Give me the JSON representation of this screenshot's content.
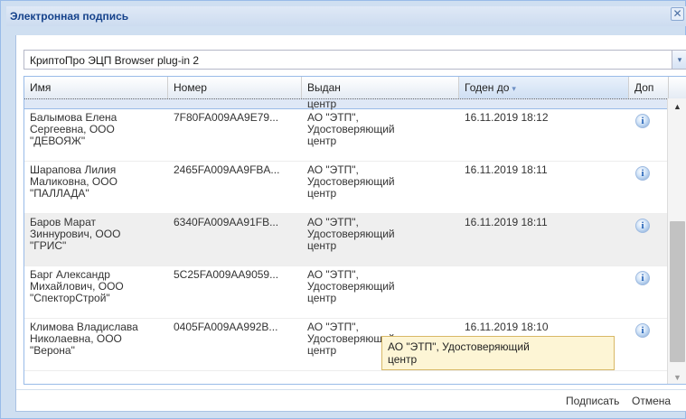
{
  "window": {
    "title": "Электронная подпись",
    "close_glyph": "✕"
  },
  "provider": {
    "value": "КриптоПро ЭЦП Browser plug-in 2",
    "trigger_glyph": "▾"
  },
  "grid": {
    "columns": [
      "Имя",
      "Номер",
      "Выдан",
      "Годен до",
      "Доп"
    ],
    "sort_glyph": "▾",
    "partial_issuer": "центр",
    "rows": [
      {
        "name": "Балымова Елена\nСергеевна, ООО\n\"ДЕВОЯЖ\"",
        "number": "7F80FA009AA9E79...",
        "issuer": "АО \"ЭТП\",\nУдостоверяющий\nцентр",
        "valid_to": "16.11.2019 18:12"
      },
      {
        "name": "Шарапова Лилия\nМаликовна, ООО\n\"ПАЛЛАДА\"",
        "number": "2465FA009AA9FBA...",
        "issuer": "АО \"ЭТП\",\nУдостоверяющий\nцентр",
        "valid_to": "16.11.2019 18:11"
      },
      {
        "name": "Баров Марат\nЗиннурович, ООО\n\"ГРИС\"",
        "number": "6340FA009AA91FB...",
        "issuer": "АО \"ЭТП\",\nУдостоверяющий\nцентр",
        "valid_to": "16.11.2019 18:11"
      },
      {
        "name": "Барг Александр\nМихайлович, ООО\n\"СпекторСтрой\"",
        "number": "5C25FA009AA9059...",
        "issuer": "АО \"ЭТП\",\nУдостоверяющий\nцентр",
        "valid_to": ""
      },
      {
        "name": "Климова Владислава\nНиколаевна, ООО\n\"Верона\"",
        "number": "0405FA009AA992B...",
        "issuer": "АО \"ЭТП\",\nУдостоверяющий\nцентр",
        "valid_to": "16.11.2019 18:10"
      }
    ],
    "info_glyph": "i",
    "scroll_up_glyph": "▲",
    "scroll_down_glyph": "▼"
  },
  "tooltip": {
    "text": "АО \"ЭТП\", Удостоверяющий\nцентр"
  },
  "footer": {
    "sign_label": "Подписать",
    "cancel_label": "Отмена"
  }
}
